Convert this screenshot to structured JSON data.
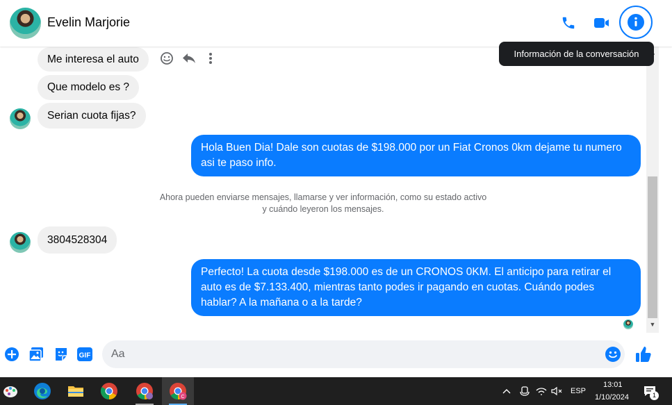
{
  "header": {
    "contact_name": "Evelin Marjorie",
    "tooltip": "Información de la conversación"
  },
  "messages": {
    "in_1": "Me interesa el auto",
    "in_2": "Que modelo es ?",
    "in_3": "Serian cuota fijas?",
    "out_1": "Hola Buen Dia! Dale son cuotas de $198.000 por un Fiat Cronos 0km dejame tu numero asi te paso info.",
    "system_1": "Ahora pueden enviarse mensajes, llamarse y ver información, como su estado activo y cuándo leyeron los mensajes.",
    "in_4": "3804528304",
    "out_2": "Perfecto! La cuota desde $198.000 es de un CRONOS 0KM. El anticipo para retirar el auto es de $7.133.400, mientras tanto podes ir pagando en cuotas. Cuándo podes hablar? A la mañana o a la tarde?"
  },
  "composer": {
    "placeholder": "Aa",
    "gif_label": "GIF"
  },
  "taskbar": {
    "lang": "ESP",
    "time": "13:01",
    "date": "1/10/2024",
    "notif_count": "1",
    "chrome_badge": "C"
  },
  "colors": {
    "accent": "#0a7cff",
    "bubble_in": "#f0f0f0",
    "taskbar": "#1f1f1f"
  }
}
